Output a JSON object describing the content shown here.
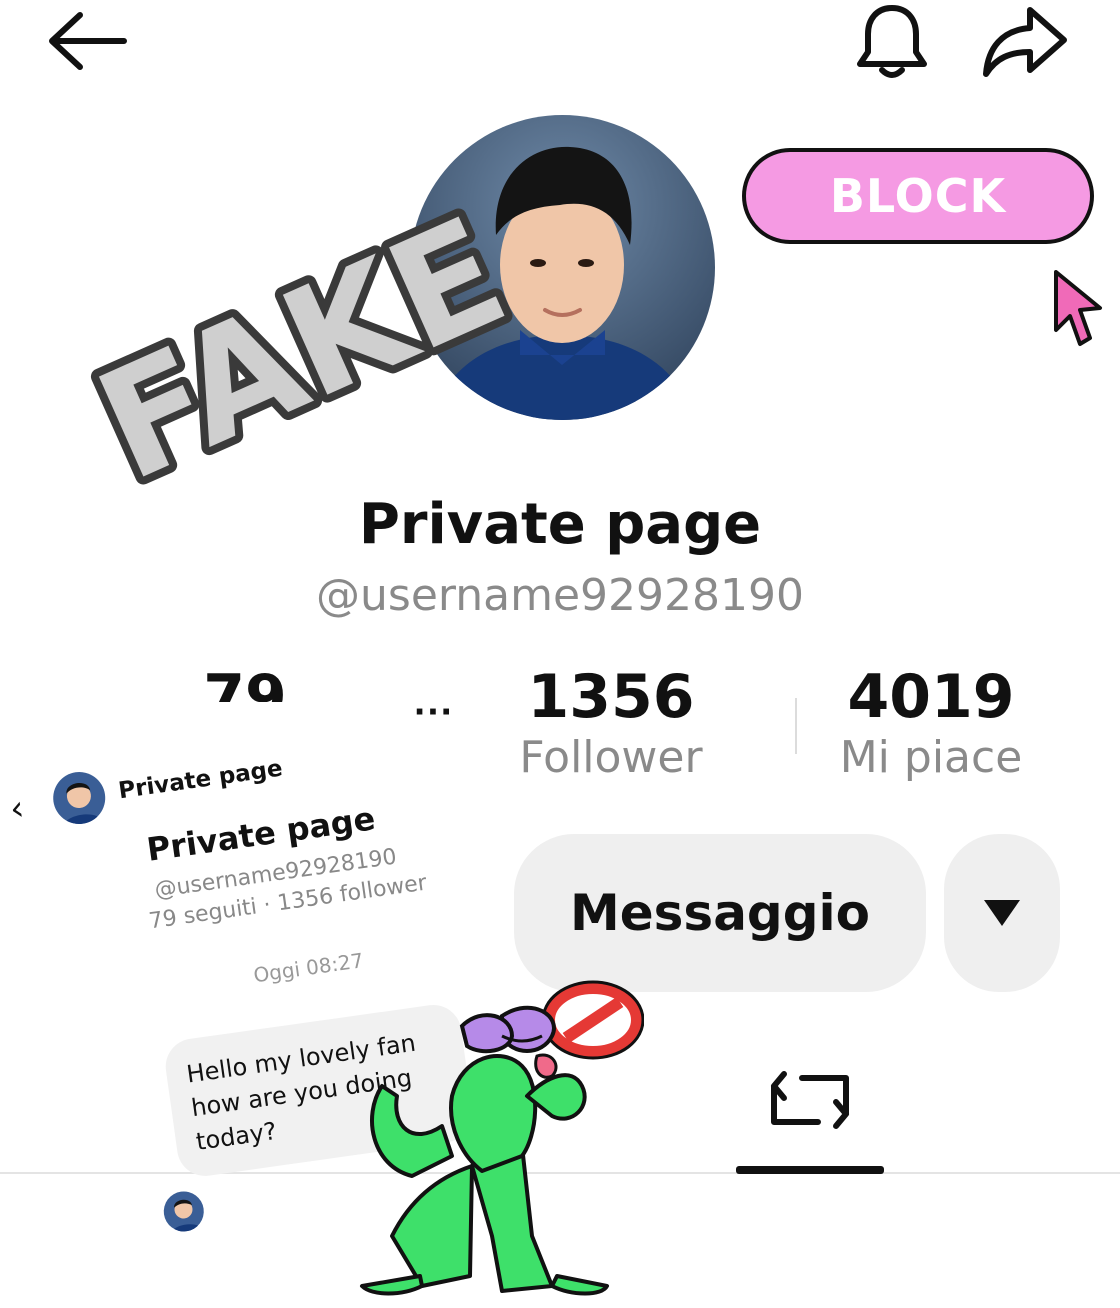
{
  "topbar": {
    "back_icon": "arrow-left-icon",
    "bell_icon": "bell-icon",
    "share_icon": "share-arrow-icon"
  },
  "sticker_fake": "FAKE",
  "block_button": {
    "label": "BLOCK",
    "color": "#f59ae3"
  },
  "profile": {
    "name": "Private page",
    "handle": "@username92928190"
  },
  "stats": {
    "following": {
      "value": "79"
    },
    "followers": {
      "value": "1356",
      "label": "Follower"
    },
    "likes": {
      "value": "4019",
      "label": "Mi piace"
    }
  },
  "actions": {
    "message_label": "Messaggio",
    "dropdown_icon": "caret-down-icon"
  },
  "tabs": {
    "repost_icon": "repost-icon"
  },
  "chat": {
    "header_name": "Private page",
    "profile_name": "Private page",
    "profile_handle": "@username92928190",
    "profile_meta": "79 seguiti · 1356 follower",
    "timestamp": "Oggi 08:27",
    "message": "Hello my lovely fan how are you doing today?"
  },
  "colors": {
    "accent_pink": "#f59ae3",
    "cursor_pink": "#f06ab8",
    "frog_green": "#3ee06a",
    "no_sign_red": "#e53935"
  }
}
